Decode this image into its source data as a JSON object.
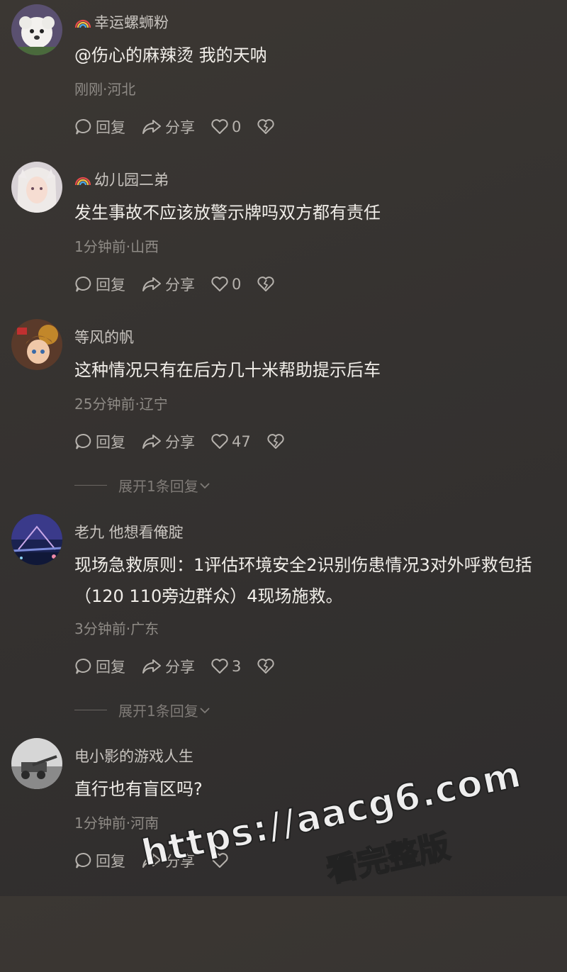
{
  "comments": [
    {
      "username": "幸运螺蛳粉",
      "rainbow": true,
      "text": "@伤心的麻辣烫  我的天呐",
      "meta": "刚刚·河北",
      "reply": "回复",
      "share": "分享",
      "likes": "0"
    },
    {
      "username": "幼儿园二弟",
      "rainbow": true,
      "text": "发生事故不应该放警示牌吗双方都有责任",
      "meta": "1分钟前·山西",
      "reply": "回复",
      "share": "分享",
      "likes": "0"
    },
    {
      "username": "等风的帆",
      "rainbow": false,
      "text": "这种情况只有在后方几十米帮助提示后车",
      "meta": "25分钟前·辽宁",
      "reply": "回复",
      "share": "分享",
      "likes": "47",
      "expand": "展开1条回复"
    },
    {
      "username": "老九 他想看俺腚",
      "rainbow": false,
      "text": "现场急救原则：1评估环境安全2识别伤患情况3对外呼救包括（120 110旁边群众）4现场施救。",
      "meta": "3分钟前·广东",
      "reply": "回复",
      "share": "分享",
      "likes": "3",
      "expand": "展开1条回复"
    },
    {
      "username": "电小影的游戏人生",
      "rainbow": false,
      "text": "直行也有盲区吗?",
      "meta": "1分钟前·河南",
      "reply": "回复",
      "share": "分享",
      "likes": ""
    }
  ],
  "watermark": {
    "url": "https://aacg6.com",
    "label": "看完整版"
  },
  "colors": {
    "background": "#363331",
    "username": "#c9c5c0",
    "text": "#f1eee9",
    "meta": "#8f8b86"
  },
  "icons": [
    "rainbow-icon",
    "reply-icon",
    "share-icon",
    "heart-icon",
    "broken-heart-icon",
    "chevron-down-icon"
  ]
}
